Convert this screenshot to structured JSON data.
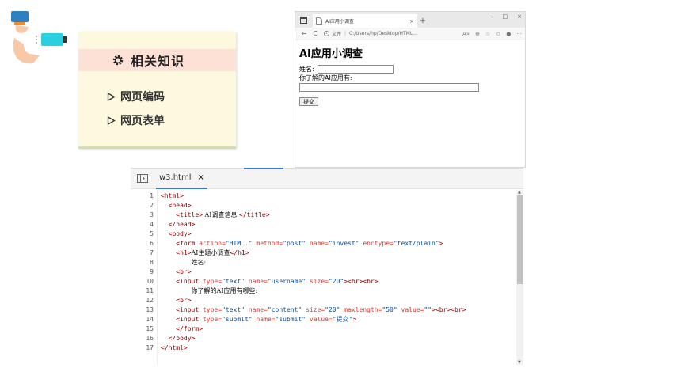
{
  "card": {
    "title": "相关知识",
    "items": [
      {
        "label": "网页编码"
      },
      {
        "label": "网页表单"
      }
    ]
  },
  "browser": {
    "tab_title": "AI应用小调查",
    "tab_close": "×",
    "new_tab": "+",
    "window_controls": {
      "minimize": "–",
      "maximize": "□",
      "close": "×"
    },
    "nav": {
      "back": "←",
      "reload": "C"
    },
    "address_prefix": "文件",
    "address": "C:/Users/hp/Desktop/HTML...",
    "page": {
      "heading": "AI应用小调查",
      "name_label": "姓名:",
      "content_label": "你了解的AI应用有:",
      "submit_label": "提交"
    }
  },
  "editor": {
    "tab_name": "w3.html",
    "tab_close": "×",
    "line_numbers": [
      "1",
      "2",
      "3",
      "4",
      "5",
      "6",
      "7",
      "8",
      "9",
      "10",
      "11",
      "12",
      "13",
      "14",
      "15",
      "16",
      "17"
    ]
  },
  "colors": {
    "tag": "#800000",
    "attribute": "#d13b2e",
    "string": "#0451a5",
    "accent": "#3a7bd5",
    "card_background": "#fdf9df",
    "card_header": "#fde1d6"
  }
}
